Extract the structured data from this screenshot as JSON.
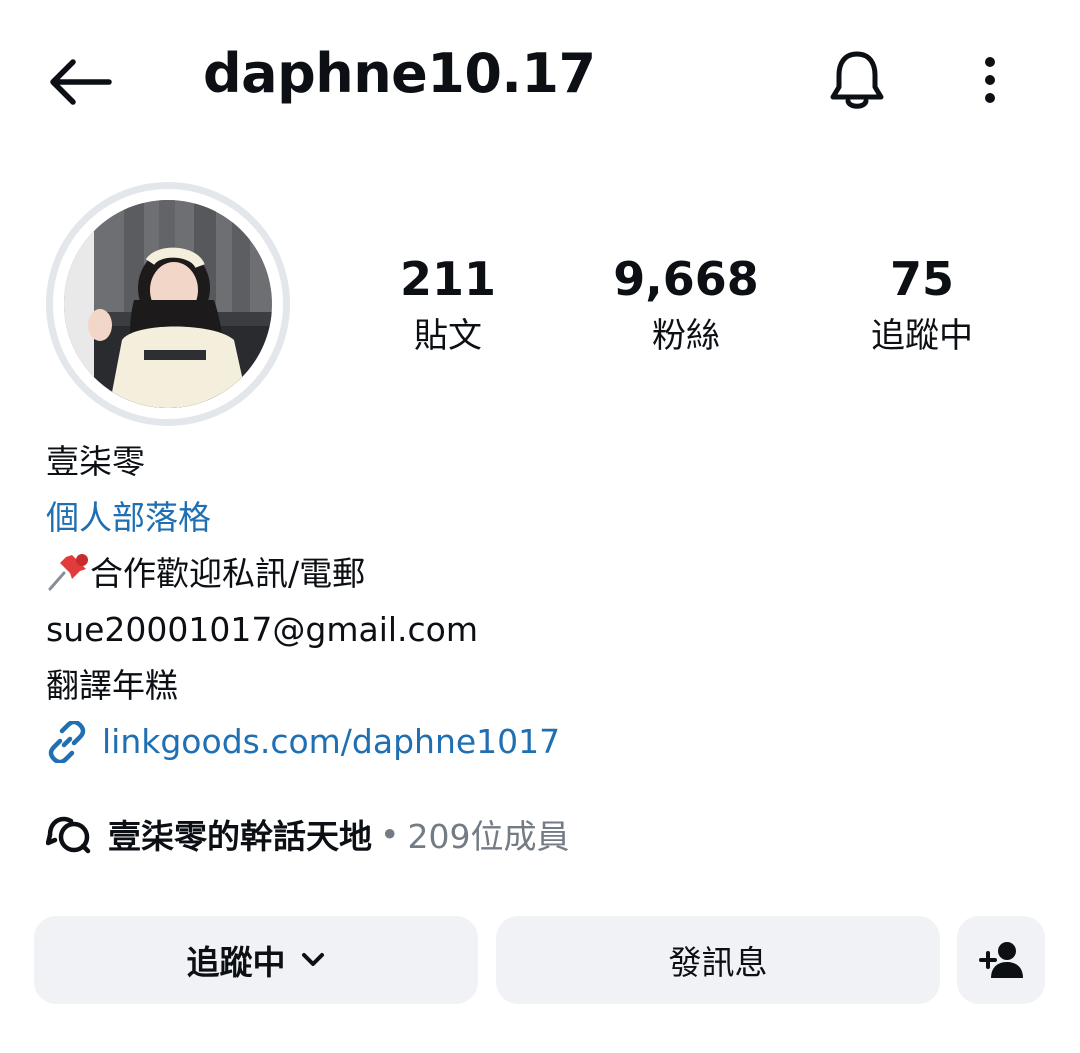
{
  "header": {
    "username": "daphne10.17",
    "icons": {
      "back": "arrow-left-icon",
      "notifications": "bell-icon",
      "more": "more-vertical-icon"
    }
  },
  "profile": {
    "avatar_icon": "profile-photo",
    "stats": [
      {
        "value": "211",
        "label": "貼文"
      },
      {
        "value": "9,668",
        "label": "粉絲"
      },
      {
        "value": "75",
        "label": "追蹤中"
      }
    ]
  },
  "bio": {
    "name": "壹柒零",
    "category": "個人部落格",
    "line1": "合作歡迎私訊/電郵",
    "pin_icon": "pushpin-icon",
    "email": "sue20001017@gmail.com",
    "translate": "翻譯年糕",
    "link_icon": "link-icon",
    "link": "linkgoods.com/daphne1017"
  },
  "community": {
    "icon": "chat-bubbles-icon",
    "name": "壹柒零的幹話天地",
    "separator": "•",
    "members": "209位成員"
  },
  "actions": {
    "follow_label": "追蹤中",
    "follow_icon": "chevron-down-icon",
    "message_label": "發訊息",
    "add_user_icon": "add-user-icon"
  },
  "colors": {
    "link": "#1f6fb2",
    "button_bg": "#f0f2f5",
    "ring": "#e3e7eb",
    "muted": "#737b85"
  }
}
